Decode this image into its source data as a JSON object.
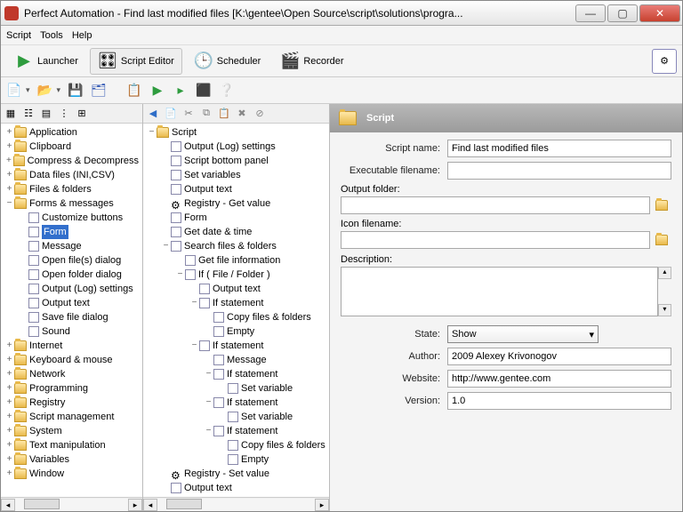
{
  "title": "Perfect Automation - Find last modified files [K:\\gentee\\Open Source\\script\\solutions\\progra...",
  "menu": {
    "script": "Script",
    "tools": "Tools",
    "help": "Help"
  },
  "toolbar1": {
    "launcher": "Launcher",
    "scripteditor": "Script Editor",
    "scheduler": "Scheduler",
    "recorder": "Recorder"
  },
  "leftTree": [
    {
      "t": "+",
      "l": "Application",
      "d": 0,
      "f": 1
    },
    {
      "t": "+",
      "l": "Clipboard",
      "d": 0,
      "f": 1
    },
    {
      "t": "+",
      "l": "Compress & Decompress",
      "d": 0,
      "f": 1
    },
    {
      "t": "+",
      "l": "Data files (INI,CSV)",
      "d": 0,
      "f": 1
    },
    {
      "t": "+",
      "l": "Files & folders",
      "d": 0,
      "f": 1
    },
    {
      "t": "−",
      "l": "Forms & messages",
      "d": 0,
      "f": 1
    },
    {
      "t": "",
      "l": "Customize buttons",
      "d": 1
    },
    {
      "t": "",
      "l": "Form",
      "d": 1,
      "sel": 1
    },
    {
      "t": "",
      "l": "Message",
      "d": 1
    },
    {
      "t": "",
      "l": "Open file(s) dialog",
      "d": 1
    },
    {
      "t": "",
      "l": "Open folder dialog",
      "d": 1
    },
    {
      "t": "",
      "l": "Output (Log) settings",
      "d": 1
    },
    {
      "t": "",
      "l": "Output text",
      "d": 1
    },
    {
      "t": "",
      "l": "Save file dialog",
      "d": 1
    },
    {
      "t": "",
      "l": "Sound",
      "d": 1
    },
    {
      "t": "+",
      "l": "Internet",
      "d": 0,
      "f": 1
    },
    {
      "t": "+",
      "l": "Keyboard & mouse",
      "d": 0,
      "f": 1
    },
    {
      "t": "+",
      "l": "Network",
      "d": 0,
      "f": 1
    },
    {
      "t": "+",
      "l": "Programming",
      "d": 0,
      "f": 1
    },
    {
      "t": "+",
      "l": "Registry",
      "d": 0,
      "f": 1
    },
    {
      "t": "+",
      "l": "Script management",
      "d": 0,
      "f": 1
    },
    {
      "t": "+",
      "l": "System",
      "d": 0,
      "f": 1
    },
    {
      "t": "+",
      "l": "Text manipulation",
      "d": 0,
      "f": 1
    },
    {
      "t": "+",
      "l": "Variables",
      "d": 0,
      "f": 1
    },
    {
      "t": "+",
      "l": "Window",
      "d": 0,
      "f": 1
    }
  ],
  "midTree": [
    {
      "t": "−",
      "l": "Script",
      "d": 0,
      "f": 1
    },
    {
      "t": "",
      "l": "Output (Log) settings",
      "d": 1
    },
    {
      "t": "",
      "l": "Script bottom panel",
      "d": 1
    },
    {
      "t": "",
      "l": "Set variables",
      "d": 1
    },
    {
      "t": "",
      "l": "Output text",
      "d": 1
    },
    {
      "t": "",
      "l": "Registry - Get value",
      "d": 1,
      "r": 1
    },
    {
      "t": "",
      "l": "Form",
      "d": 1
    },
    {
      "t": "",
      "l": "Get date & time",
      "d": 1
    },
    {
      "t": "−",
      "l": "Search files & folders",
      "d": 1
    },
    {
      "t": "",
      "l": "Get file information",
      "d": 2
    },
    {
      "t": "−",
      "l": "If ( File / Folder )",
      "d": 2
    },
    {
      "t": "",
      "l": "Output text",
      "d": 3
    },
    {
      "t": "−",
      "l": "If statement",
      "d": 3
    },
    {
      "t": "",
      "l": "Copy files & folders",
      "d": 4
    },
    {
      "t": "",
      "l": "Empty",
      "d": 4
    },
    {
      "t": "−",
      "l": "If statement",
      "d": 3
    },
    {
      "t": "",
      "l": "Message",
      "d": 4
    },
    {
      "t": "−",
      "l": "If statement",
      "d": 4
    },
    {
      "t": "",
      "l": "Set variable",
      "d": 5
    },
    {
      "t": "−",
      "l": "If statement",
      "d": 4
    },
    {
      "t": "",
      "l": "Set variable",
      "d": 5
    },
    {
      "t": "−",
      "l": "If statement",
      "d": 4
    },
    {
      "t": "",
      "l": "Copy files & folders",
      "d": 5
    },
    {
      "t": "",
      "l": "Empty",
      "d": 5
    },
    {
      "t": "",
      "l": "Registry - Set value",
      "d": 1,
      "r": 1
    },
    {
      "t": "",
      "l": "Output text",
      "d": 1
    }
  ],
  "panel": {
    "header": "Script",
    "scriptname_lbl": "Script name:",
    "scriptname": "Find last modified files",
    "exe_lbl": "Executable filename:",
    "exe": "",
    "outfolder_lbl": "Output folder:",
    "outfolder": "",
    "iconfile_lbl": "Icon filename:",
    "iconfile": "",
    "desc_lbl": "Description:",
    "state_lbl": "State:",
    "state": "Show",
    "author_lbl": "Author:",
    "author": "2009 Alexey Krivonogov",
    "website_lbl": "Website:",
    "website": "http://www.gentee.com",
    "version_lbl": "Version:",
    "version": "1.0"
  }
}
